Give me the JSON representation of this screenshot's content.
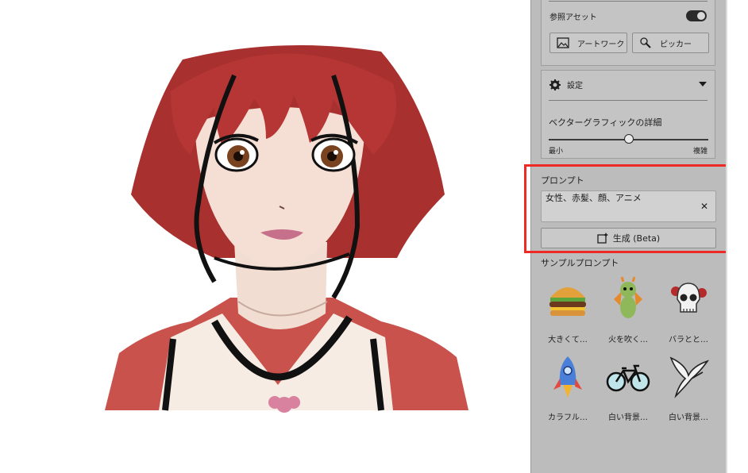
{
  "panel": {
    "ref_assets": {
      "label": "参照アセット",
      "toggle_on": true
    },
    "artwork_button": "アートワーク",
    "picker_button": "ピッカー",
    "settings": {
      "title": "設定"
    },
    "vector_detail": {
      "label": "ベクターグラフィックの詳細",
      "min_label": "最小",
      "max_label": "複雑",
      "level": 0.5
    },
    "prompt": {
      "label": "プロンプト",
      "value": "女性、赤髪、顔、アニメ",
      "clear_glyph": "✕"
    },
    "generate_button": "生成 (Beta)",
    "samples": {
      "heading": "サンプルプロンプト",
      "items": [
        {
          "caption": "大きくて…",
          "icon": "burger-icon"
        },
        {
          "caption": "火を吹く…",
          "icon": "dragon-icon"
        },
        {
          "caption": "バラとと…",
          "icon": "skull-icon"
        },
        {
          "caption": "カラフル…",
          "icon": "rocket-icon"
        },
        {
          "caption": "白い背景…",
          "icon": "bicycle-icon"
        },
        {
          "caption": "白い背景…",
          "icon": "crane-bird-icon"
        }
      ]
    }
  },
  "highlight_color": "#ee2a24"
}
